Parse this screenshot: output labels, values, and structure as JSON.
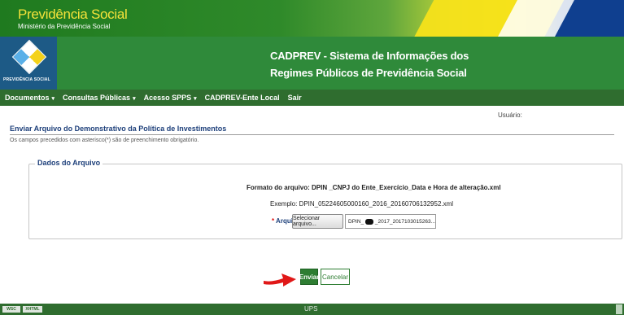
{
  "banner": {
    "title": "Previdência Social",
    "subtitle": "Ministério da Previdência Social"
  },
  "header": {
    "logo_text": "PREVIDÊNCIA SOCIAL",
    "app_title_line1": "CADPREV - Sistema de Informações dos",
    "app_title_line2": "Regimes Públicos de Previdência Social"
  },
  "nav": {
    "items": [
      {
        "label": "Documentos",
        "has_caret": true
      },
      {
        "label": "Consultas Públicas",
        "has_caret": true
      },
      {
        "label": "Acesso SPPS",
        "has_caret": true
      },
      {
        "label": "CADPREV-Ente Local",
        "has_caret": false
      },
      {
        "label": "Sair",
        "has_caret": false
      }
    ],
    "caret_glyph": "▾"
  },
  "user": {
    "label": "Usuário:"
  },
  "page": {
    "heading": "Enviar Arquivo do Demonstrativo da Política de Investimentos",
    "required_note": "Os campos precedidos com asterisco(*) são de preenchimento obrigatório."
  },
  "file_section": {
    "legend": "Dados do Arquivo",
    "format_text": "Formato do arquivo: DPIN _CNPJ do Ente_Exercício_Data e Hora de alteração.xml",
    "example_text": "Exemplo: DPIN_05224605000160_2016_20160706132952.xml",
    "required_mark": "* ",
    "file_label": "Arquivo:",
    "select_button": "Selecionar arquivo...",
    "file_value_prefix": "DPIN_",
    "file_value_suffix": "_2017_2017103015263..."
  },
  "actions": {
    "send_label": "Enviar",
    "cancel_label": "Cancelar"
  },
  "footer": {
    "badge_1": "WSC",
    "badge_2": "XHTML",
    "center_text": "UPS"
  },
  "colors": {
    "nav_green": "#2f6d2f",
    "header_green": "#2f8a3a",
    "accent_yellow": "#f4e23a",
    "heading_blue": "#1d3f7a",
    "arrow_red": "#e01818"
  },
  "icons": {
    "logo": "previdencia-logo-icon",
    "arrow": "red-arrow-icon"
  }
}
